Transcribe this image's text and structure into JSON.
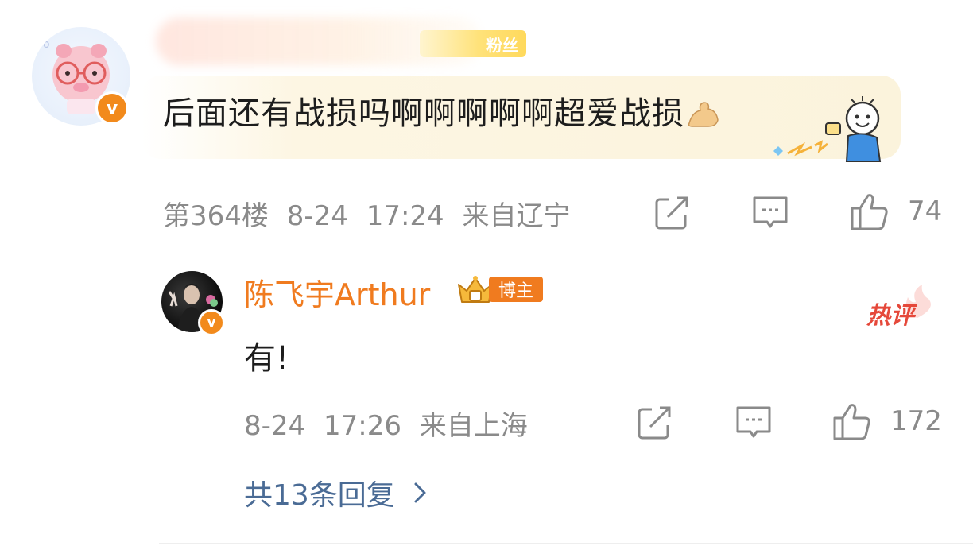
{
  "comment": {
    "fan_badge_label": "粉丝",
    "text": "后面还有战损吗啊啊啊啊啊超爱战损",
    "floor": "第364楼",
    "date": "8-24",
    "time": "17:24",
    "location": "来自辽宁",
    "like_count": "74"
  },
  "reply": {
    "author": "陈飞宇Arthur",
    "author_badge": "博主",
    "text": "有!",
    "hot_label": "热评",
    "date": "8-24",
    "time": "17:26",
    "location": "来自上海",
    "like_count": "172"
  },
  "footer": {
    "more_replies": "共13条回复"
  },
  "colors": {
    "accent_orange": "#f07b1f",
    "verified_badge": "#f28a1c",
    "meta_gray": "#8a8a8a",
    "link_blue": "#4a6b95",
    "hot_red": "#e5483a"
  }
}
